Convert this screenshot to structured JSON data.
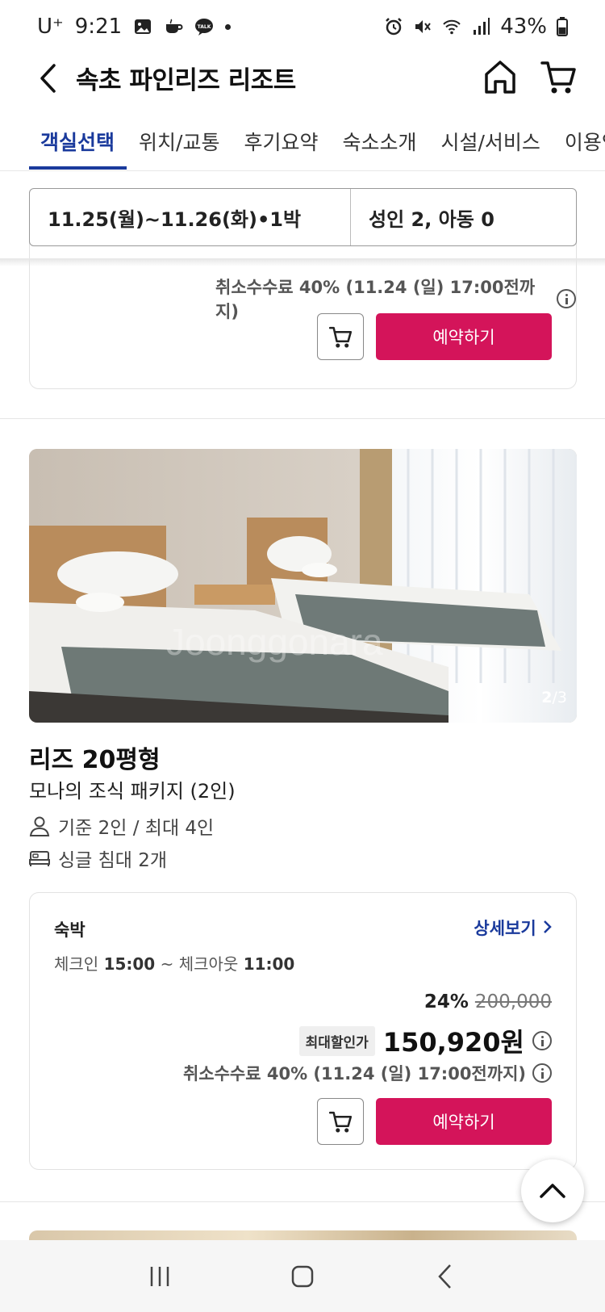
{
  "status_bar": {
    "carrier": "U⁺",
    "time": "9:21",
    "battery": "43%"
  },
  "header": {
    "title": "속초 파인리즈 리조트"
  },
  "tabs": [
    {
      "label": "객실선택",
      "active": true
    },
    {
      "label": "위치/교통"
    },
    {
      "label": "후기요약"
    },
    {
      "label": "숙소소개"
    },
    {
      "label": "시설/서비스"
    },
    {
      "label": "이용안내"
    }
  ],
  "search": {
    "dates": "11.25(월)~11.26(화)•1박",
    "guests": "성인 2, 아동 0"
  },
  "prev_offer": {
    "cancel_fee": "취소수수료 40% (11.24 (일) 17:00전까지)",
    "book_label": "예약하기"
  },
  "room": {
    "image_index": "2",
    "image_total": "/3",
    "name": "리즈 20평형",
    "package": "모나의 조식 패키지 (2인)",
    "capacity": "기준 2인 / 최대 4인",
    "bed": "싱글 침대 2개"
  },
  "offer": {
    "type": "숙박",
    "detail_link": "상세보기",
    "checkin_label": "체크인",
    "checkin_time": "15:00",
    "sep": "~",
    "checkout_label": "체크아웃",
    "checkout_time": "11:00",
    "discount": "24%",
    "original_price": "200,000",
    "max_discount_badge": "최대할인가",
    "price": "150,920원",
    "cancel_fee": "취소수수료 40% (11.24 (일) 17:00전까지)",
    "book_label": "예약하기"
  },
  "colors": {
    "accent": "#1a3a9c",
    "book": "#d4145a"
  }
}
